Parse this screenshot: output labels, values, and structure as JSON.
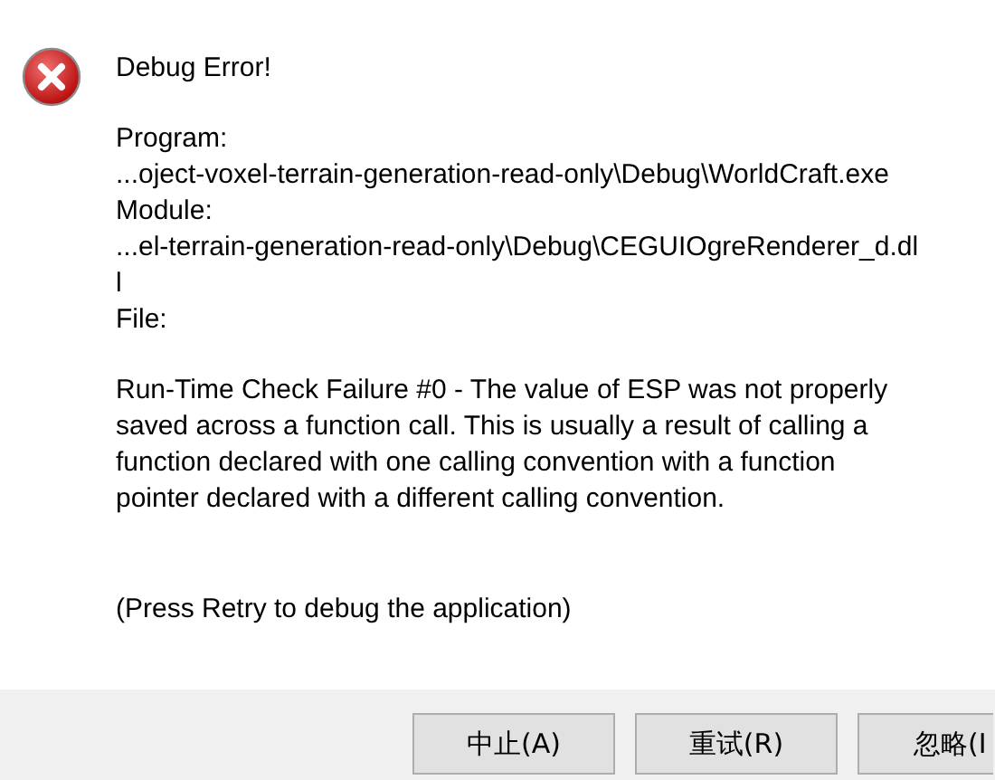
{
  "dialog": {
    "title": "Debug Error!",
    "program_label": "Program:",
    "program_path": "...oject-voxel-terrain-generation-read-only\\Debug\\WorldCraft.exe",
    "module_label": "Module:",
    "module_path": [
      "...el-terrain-generation-read-only\\Debug\\CEGUIOgreRenderer_d.dl",
      "l"
    ],
    "file_label": "File:",
    "message": "Run-Time Check Failure #0 - The value of ESP was not properly\nsaved across a function call.  This is usually a result of calling a\nfunction declared with one calling convention with a function\npointer declared with a different calling convention.",
    "hint": "(Press Retry to debug the application)"
  },
  "buttons": [
    {
      "label": "中止(A)"
    },
    {
      "label": "重试(R)"
    },
    {
      "label": "忽略(I"
    }
  ]
}
